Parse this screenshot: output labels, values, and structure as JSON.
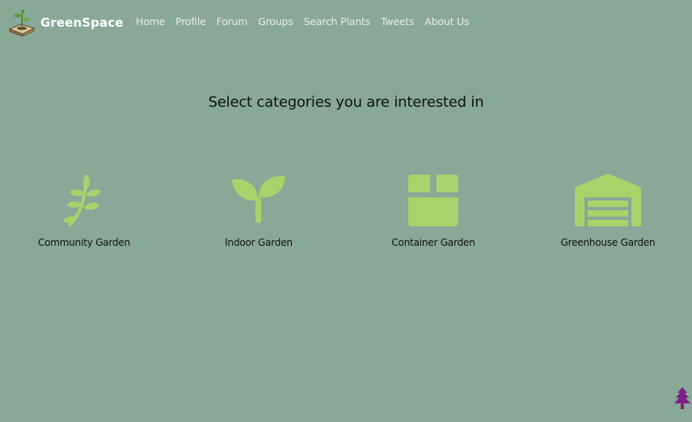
{
  "brand": {
    "name": "GreenSpace",
    "logo_icon": "potted-sprout-logo"
  },
  "nav": {
    "items": [
      {
        "label": "Home"
      },
      {
        "label": "Profile"
      },
      {
        "label": "Forum"
      },
      {
        "label": "Groups"
      },
      {
        "label": "Search Plants"
      },
      {
        "label": "Tweets"
      },
      {
        "label": "About Us"
      }
    ]
  },
  "page": {
    "heading": "Select categories you are interested in"
  },
  "categories": [
    {
      "label": "Community Garden",
      "icon": "leafy-branch-icon"
    },
    {
      "label": "Indoor Garden",
      "icon": "seedling-icon"
    },
    {
      "label": "Container Garden",
      "icon": "box-icon"
    },
    {
      "label": "Greenhouse Garden",
      "icon": "warehouse-icon"
    }
  ],
  "floating_button": {
    "icon": "tree-icon"
  },
  "colors": {
    "background": "#88a898",
    "icon_green": "#a6d46a",
    "tree_purple": "#7b1f86",
    "nav_text": "#ebebeb",
    "brand_text": "#ffffff",
    "body_text": "#111111"
  }
}
